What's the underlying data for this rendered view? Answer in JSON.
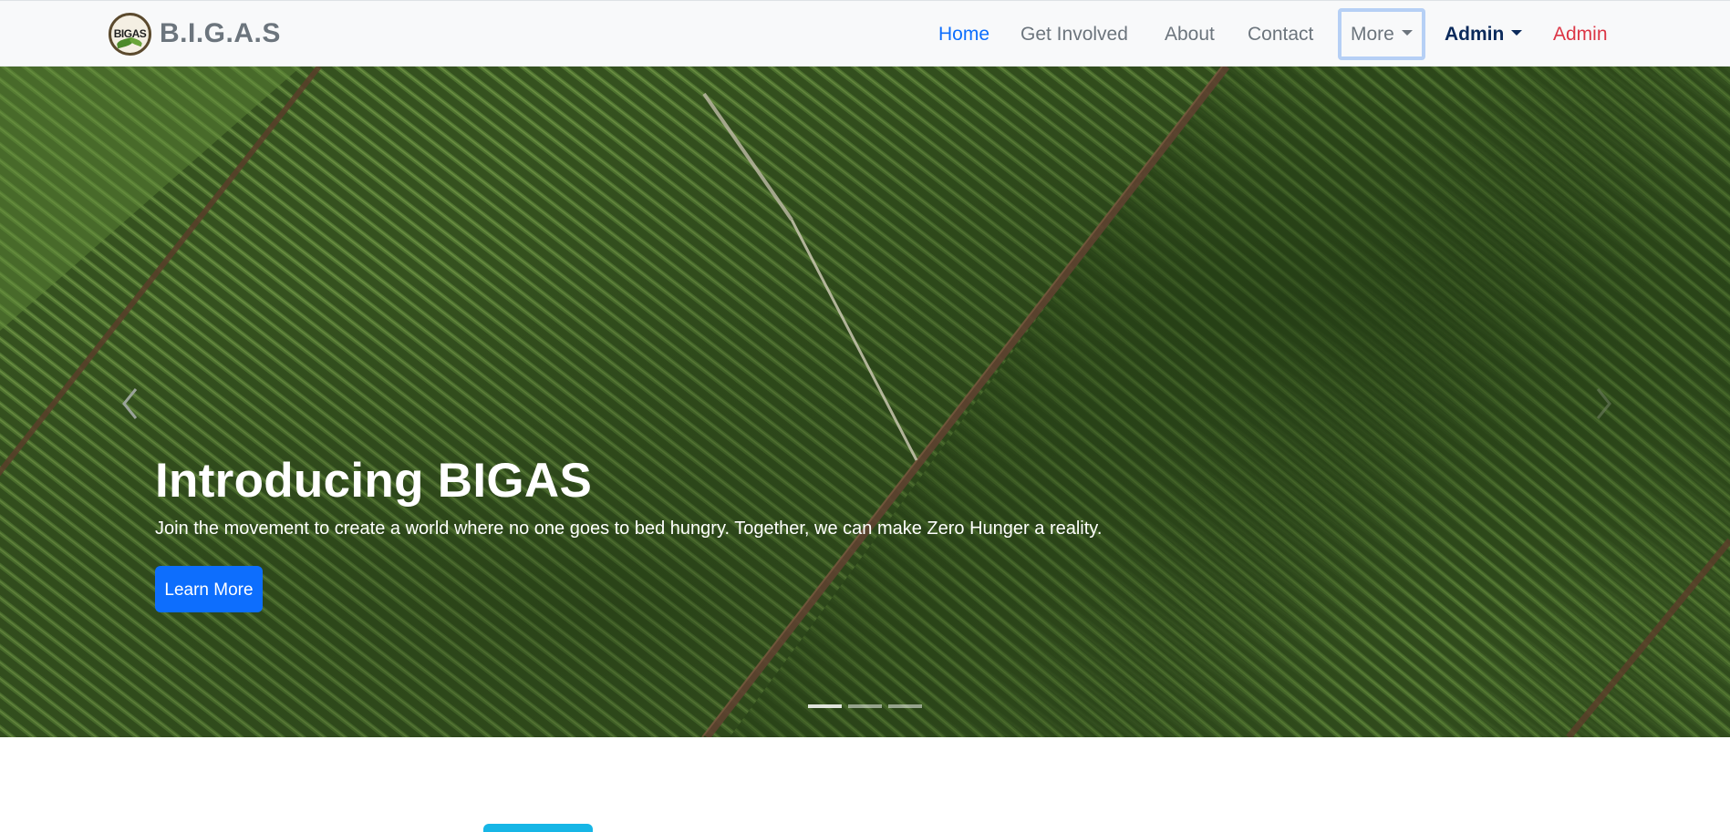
{
  "brand": {
    "logo_text": "BIGAS",
    "name": "B.I.G.A.S"
  },
  "nav": {
    "items": [
      {
        "label": "Home"
      },
      {
        "label": "Get Involved"
      },
      {
        "label": "About"
      },
      {
        "label": "Contact"
      },
      {
        "label": "More"
      },
      {
        "label": "Admin"
      },
      {
        "label": "Admin"
      }
    ]
  },
  "hero": {
    "title": "Introducing BIGAS",
    "subtitle": "Join the movement to create a world where no one goes to bed hungry. Together, we can make Zero Hunger a reality.",
    "button_label": "Learn More",
    "slides_count": 3,
    "active_slide": 1
  },
  "colors": {
    "primary": "#0d6efd",
    "admin_dark": "#0b2a5b",
    "admin_red": "#dc3545",
    "nav_text": "#6c757d"
  },
  "icons": [
    "chevron-left-icon",
    "chevron-right-icon"
  ]
}
